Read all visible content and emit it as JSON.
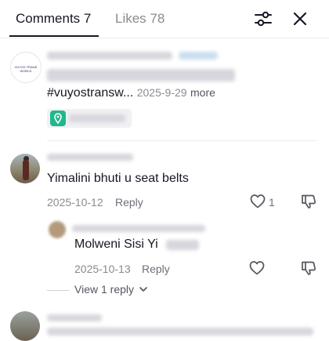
{
  "tabs": {
    "comments_label": "Comments 7",
    "likes_label": "Likes 78"
  },
  "header_icons": {
    "filter": "sliders-icon",
    "close": "close-icon"
  },
  "pinned_comment": {
    "avatar_text": "VUYOS TRANS WORLD",
    "hashtag_text": "#vuyostransw...",
    "date": "2025-9-29",
    "more_label": "more",
    "location_icon": "location-pin-icon"
  },
  "comments": [
    {
      "text": "Yimalini bhuti u seat belts",
      "date": "2025-10-12",
      "reply_label": "Reply",
      "like_count": "1"
    }
  ],
  "replies": [
    {
      "text": "Molweni Sisi Yi",
      "date": "2025-10-13",
      "reply_label": "Reply"
    }
  ],
  "view_replies_label": "View 1 reply"
}
